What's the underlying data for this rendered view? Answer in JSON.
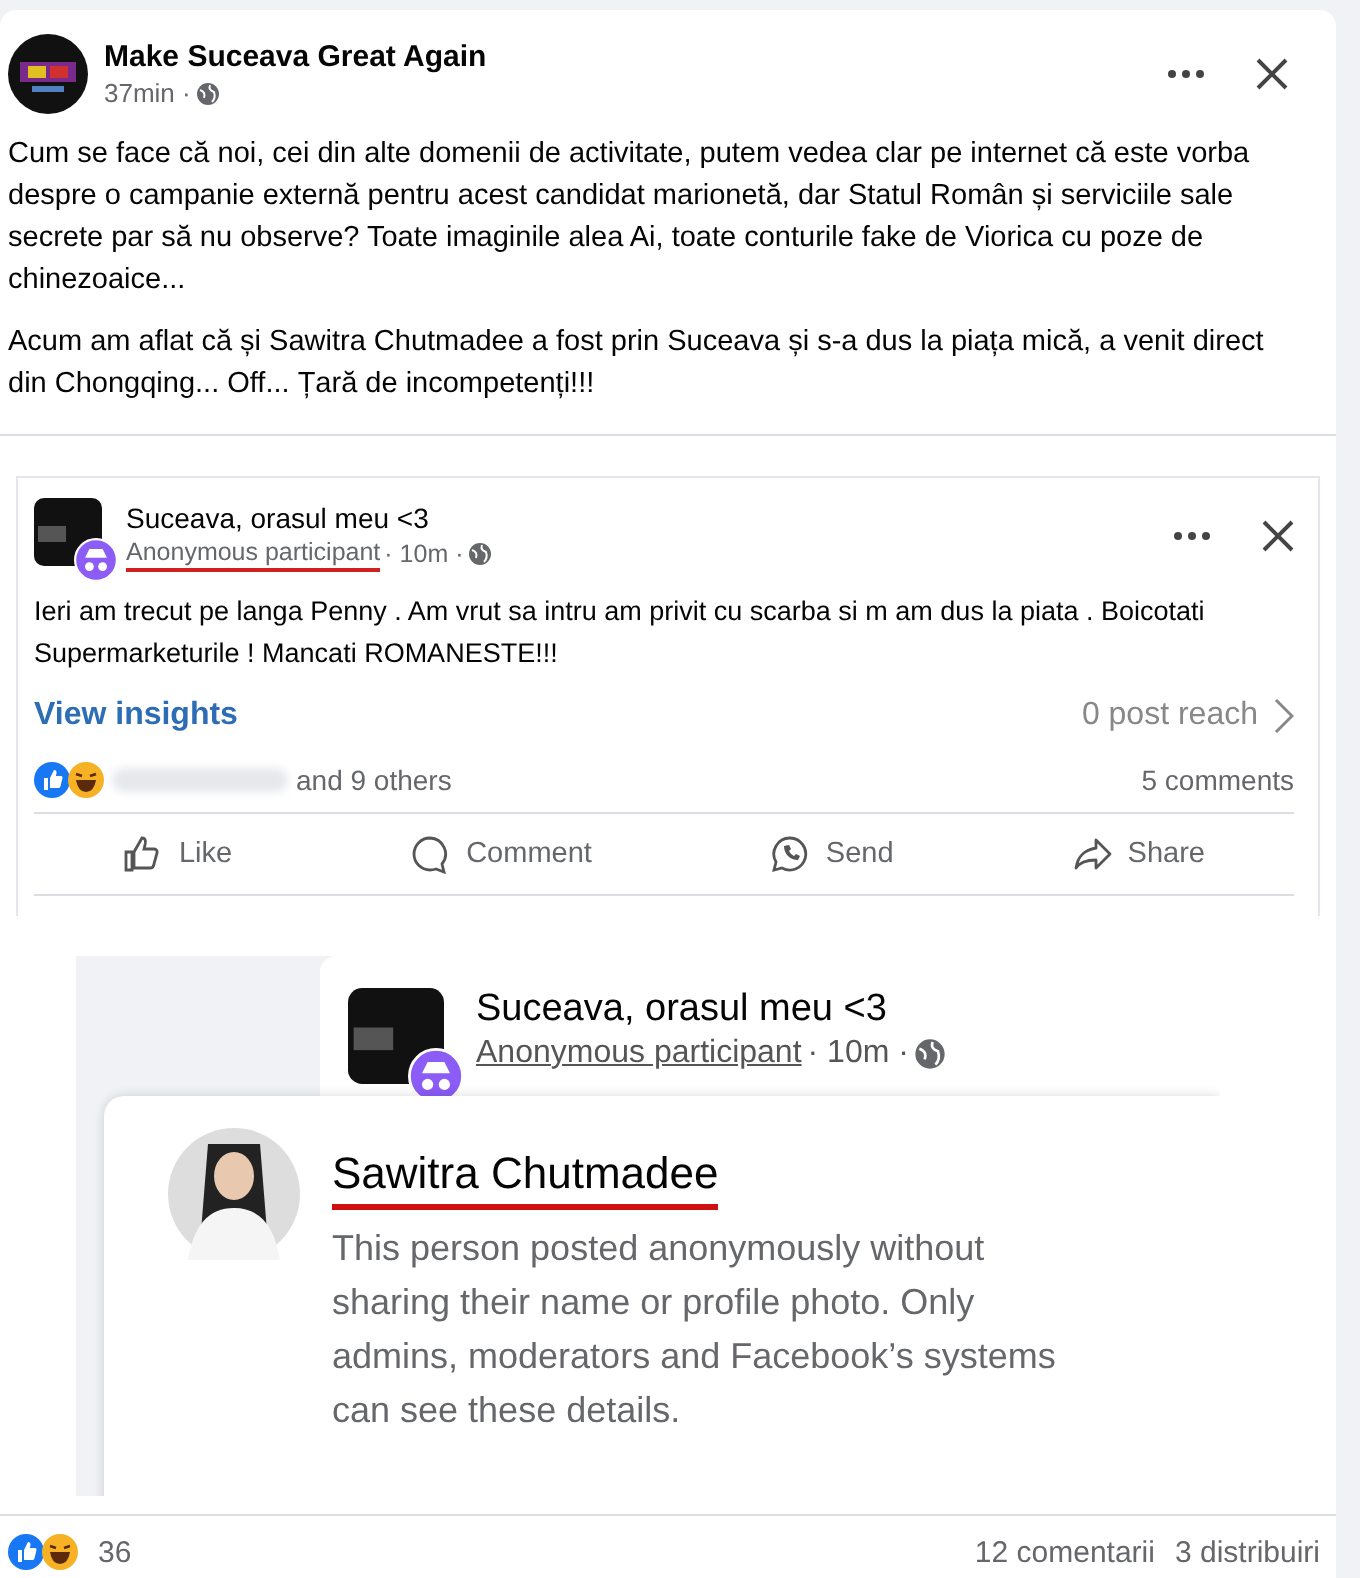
{
  "post": {
    "page_name": "Make Suceava Great Again",
    "time": "37min ·",
    "paragraphs": [
      "Cum se face că noi, cei din alte domenii de activitate, putem vedea clar pe internet că este vorba despre o campanie externă pentru acest candidat marionetă, dar Statul Român și serviciile sale secrete par să nu observe? Toate imaginile alea Ai, toate conturile fake de Viorica cu poze de chinezoaice...",
      "Acum am aflat că și Sawitra Chutmadee a fost prin Suceava și s-a dus la piața mică, a venit direct din Chongqing... Off... Țară de incompetenți!!!"
    ]
  },
  "shared_post": {
    "group": "Suceava, orasul meu <3",
    "author": "Anonymous participant",
    "time": "· 10m ·",
    "text": "Ieri am trecut pe langa Penny . Am vrut sa intru am privit cu scarba si m am dus la piata . Boicotati Supermarketurile ! Mancati ROMANESTE!!!",
    "insights_link": "View insights",
    "reach": "0 post reach",
    "reactions_others": "and 9 others",
    "comments": "5 comments",
    "actions": [
      {
        "kind": "like",
        "label": "Like"
      },
      {
        "kind": "comment",
        "label": "Comment"
      },
      {
        "kind": "send",
        "label": "Send"
      },
      {
        "kind": "share",
        "label": "Share"
      }
    ]
  },
  "zoomed_capture": {
    "group": "Suceava, orasul meu <3",
    "author": "Anonymous participant",
    "time": "· 10m ·",
    "popup": {
      "name": "Sawitra Chutmadee",
      "description": "This person posted anonymously without sharing their name or profile photo. Only admins, moderators and Facebook’s systems can see these details."
    }
  },
  "footer": {
    "reactions_count": "36",
    "comments": "12 comentarii",
    "shares": "3 distribuiri"
  }
}
